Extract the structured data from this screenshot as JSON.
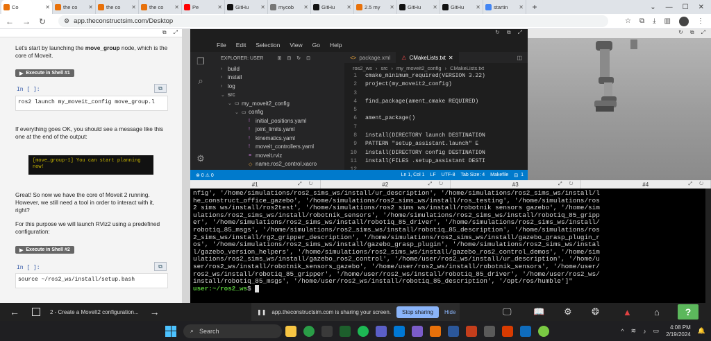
{
  "browser": {
    "tabs": [
      {
        "label": "Co",
        "color": "#e8710a",
        "active": true
      },
      {
        "label": "the co",
        "color": "#e8710a"
      },
      {
        "label": "the co",
        "color": "#e8710a"
      },
      {
        "label": "the co",
        "color": "#e8710a"
      },
      {
        "label": "Pe",
        "color": "#ff0000"
      },
      {
        "label": "GitHu",
        "color": "#111111"
      },
      {
        "label": "mycob",
        "color": "#777777"
      },
      {
        "label": "GitHu",
        "color": "#111111"
      },
      {
        "label": "2.5 my",
        "color": "#e8710a"
      },
      {
        "label": "GitHu",
        "color": "#111111"
      },
      {
        "label": "GitHu",
        "color": "#111111"
      },
      {
        "label": "startin",
        "color": "#4285f4"
      }
    ],
    "new_tab": "+",
    "url": "app.theconstructsim.com/Desktop"
  },
  "notebook": {
    "p1_pre": "Let's start by launching the ",
    "p1_bold": "move_group",
    "p1_post": " node, which is the core of Moveit.",
    "exec1": "Execute in Shell #1",
    "in1": "In [ ]:",
    "code1": "ros2 launch my_moveit_config move_group.l",
    "p2": "If everything goes OK, you should see a message like this one at the end of the output:",
    "output": "[move_group-1] You can start planning now!",
    "p3": "Great! So now we have the core of Moveit 2 running. However, we still need a tool in order to interact with it, right?",
    "p4": "For this purpose we will launch RViz2 using a predefined configuration:",
    "exec2": "Execute in Shell #2",
    "in2": "In [ ]:",
    "code2": "source ~/ros2_ws/install/setup.bash"
  },
  "vscode": {
    "menu": [
      "File",
      "Edit",
      "Selection",
      "View",
      "Go",
      "Help"
    ],
    "explorer_title": "EXPLORER: USER",
    "tree": [
      {
        "label": "build",
        "indent": 0,
        "type": "folder",
        "open": false
      },
      {
        "label": "install",
        "indent": 0,
        "type": "folder",
        "open": false
      },
      {
        "label": "log",
        "indent": 0,
        "type": "folder",
        "open": false
      },
      {
        "label": "src",
        "indent": 0,
        "type": "folder",
        "open": true
      },
      {
        "label": "my_moveit2_config",
        "indent": 1,
        "type": "folder",
        "open": true
      },
      {
        "label": "config",
        "indent": 2,
        "type": "folder",
        "open": true
      },
      {
        "label": "initial_positions.yaml",
        "indent": 3,
        "type": "yaml"
      },
      {
        "label": "joint_limits.yaml",
        "indent": 3,
        "type": "yaml"
      },
      {
        "label": "kinematics.yaml",
        "indent": 3,
        "type": "yaml"
      },
      {
        "label": "moveit_controllers.yaml",
        "indent": 3,
        "type": "yaml"
      },
      {
        "label": "moveit.rviz",
        "indent": 3,
        "type": "rviz"
      },
      {
        "label": "name.ros2_control.xacro",
        "indent": 3,
        "type": "xacro"
      }
    ],
    "tabs": [
      {
        "label": "package.xml",
        "active": false
      },
      {
        "label": "CMakeLists.txt",
        "active": true
      }
    ],
    "breadcrumb": [
      "ros2_ws",
      "src",
      "my_moveit2_config",
      "CMakeLists.txt"
    ],
    "code": [
      {
        "n": "1",
        "text": "cmake_minimum_required(VERSION 3.22)"
      },
      {
        "n": "2",
        "text": "project(my_moveit2_config)"
      },
      {
        "n": "3",
        "text": ""
      },
      {
        "n": "4",
        "text": "find_package(ament_cmake REQUIRED)"
      },
      {
        "n": "5",
        "text": ""
      },
      {
        "n": "6",
        "text": "ament_package()"
      },
      {
        "n": "7",
        "text": ""
      },
      {
        "n": "8",
        "text": "install(DIRECTORY launch DESTINATION"
      },
      {
        "n": "9",
        "text": "  PATTERN \"setup_assistant.launch\" E"
      },
      {
        "n": "10",
        "text": "install(DIRECTORY config DESTINATION"
      },
      {
        "n": "11",
        "text": "install(FILES .setup_assistant DESTI"
      },
      {
        "n": "12",
        "text": ""
      }
    ],
    "status": {
      "problems": "⊗ 0 ⚠ 0",
      "position": "Ln 1, Col 1",
      "eol": "LF",
      "encoding": "UTF-8",
      "tab": "Tab Size: 4",
      "lang": "Makefile",
      "count": "1"
    }
  },
  "terminals": {
    "tabs": [
      "#1",
      "#2",
      "#3",
      "#4"
    ],
    "lines": [
      "nfig', '/home/simulations/ros2_sims_ws/install/ur_description', '/home/simulations/ros2_sims_ws/install/l",
      "he_construct_office_gazebo', '/home/simulations/ros2_sims_ws/install/ros_testing', '/home/simulations/ros",
      "2 sims ws/install/ros2test', '/home/simulations/ros2 sims ws/install/robotnik sensors gazebo', '/home/sim",
      "ulations/ros2_sims_ws/install/robotnik_sensors', '/home/simulations/ros2_sims_ws/install/robotiq_85_gripp",
      "er', '/home/simulations/ros2_sims_ws/install/robotiq_85_driver', '/home/simulations/ros2_sims_ws/install/",
      "robotiq_85_msgs', '/home/simulations/ros2_sims_ws/install/robotiq_85_description', '/home/simulations/ros",
      "2_sims_ws/install/rg2_gripper_description', '/home/simulations/ros2_sims_ws/install/gazebo_grasp_plugin_r",
      "os', '/home/simulations/ros2_sims_ws/install/gazebo_grasp_plugin', '/home/simulations/ros2_sims_ws/instal",
      "l/gazebo_version_helpers', '/home/simulations/ros2_sims_ws/install/gazebo_ros2_control_demos', '/home/sim",
      "ulations/ros2_sims_ws/install/gazebo_ros2_control', '/home/user/ros2_ws/install/ur_description', '/home/u",
      "ser/ros2_ws/install/robotnik_sensors_gazebo', '/home/user/ros2_ws/install/robotnik_sensors', '/home/user/",
      "ros2_ws/install/robotiq_85_gripper', '/home/user/ros2_ws/install/robotiq_85_driver', '/home/user/ros2_ws/",
      "install/robotiq_85_msgs', '/home/user/ros2_ws/install/robotiq_85_description', '/opt/ros/humble']\""
    ],
    "prompt_user": "user:~/ros2_ws",
    "prompt_suffix": "$ "
  },
  "bottombar": {
    "title": "2 - Create a MoveIt2 configuration...",
    "sharing_msg": "app.theconstructsim.com is sharing your screen.",
    "stop_label": "Stop sharing",
    "hide_label": "Hide",
    "help_label": "?"
  },
  "taskbar": {
    "search_placeholder": "Search",
    "time": "4:08 PM",
    "date": "2/19/2024"
  },
  "colors": {
    "vscode_status": "#007acc",
    "terminal_prompt": "#57c83a",
    "help_button": "#5cb85c"
  }
}
